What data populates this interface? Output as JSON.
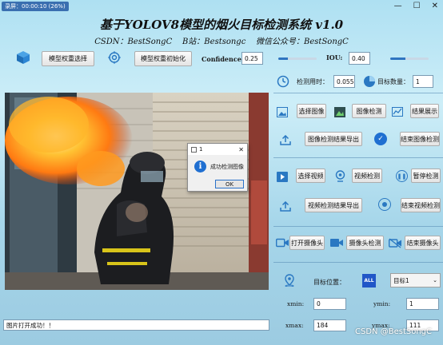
{
  "window": {
    "title": "基于YOLOV8模型的烟火目标检测系统 v1.0",
    "subtitle": "CSDN：BestSongC    B站：Bestsongc    微信公众号：BestSongC",
    "top_left_tag": "录屏：00:00:10 (26%)"
  },
  "toolbar": {
    "select_weights": "模型权重选择",
    "init_weights": "模型权重初始化",
    "confidence_label": "Confidence:",
    "confidence_value": "0.25",
    "confidence_level": 0.25,
    "iou_label": "IOU:",
    "iou_value": "0.40",
    "iou_level": 0.4
  },
  "stats": {
    "time_label": "检测用时：",
    "time_value": "0.055",
    "count_label": "目标数量：",
    "count_value": "1"
  },
  "image_panel": {
    "select": "选择图像",
    "detect": "图像检测",
    "show": "结果展示",
    "export": "图像检测结果导出",
    "stop": "结束图像检测"
  },
  "video_panel": {
    "select": "选择视频",
    "detect": "视频检测",
    "pause": "暂停检测",
    "export": "视频检测结果导出",
    "stop": "结束视频检测"
  },
  "camera_panel": {
    "open": "打开摄像头",
    "detect": "摄像头检测",
    "stop": "结束摄像头"
  },
  "target": {
    "pos_label": "目标位置：",
    "select_value": "目标1",
    "all_label": "ALL"
  },
  "coords": {
    "xmin_label": "xmin:",
    "xmin_value": "0",
    "ymin_label": "ymin:",
    "ymin_value": "1",
    "xmax_label": "xmax:",
    "xmax_value": "184",
    "ymax_label": "ymax:",
    "ymax_value": "111"
  },
  "dialog": {
    "title": "1",
    "message": "成功检测图像",
    "ok": "OK"
  },
  "status_bar": {
    "text": "图片打开成功！！"
  },
  "watermark": "CSDN @BestSongC",
  "colors": {
    "accent": "#3a7cc2",
    "background": "#bfe6f5"
  }
}
